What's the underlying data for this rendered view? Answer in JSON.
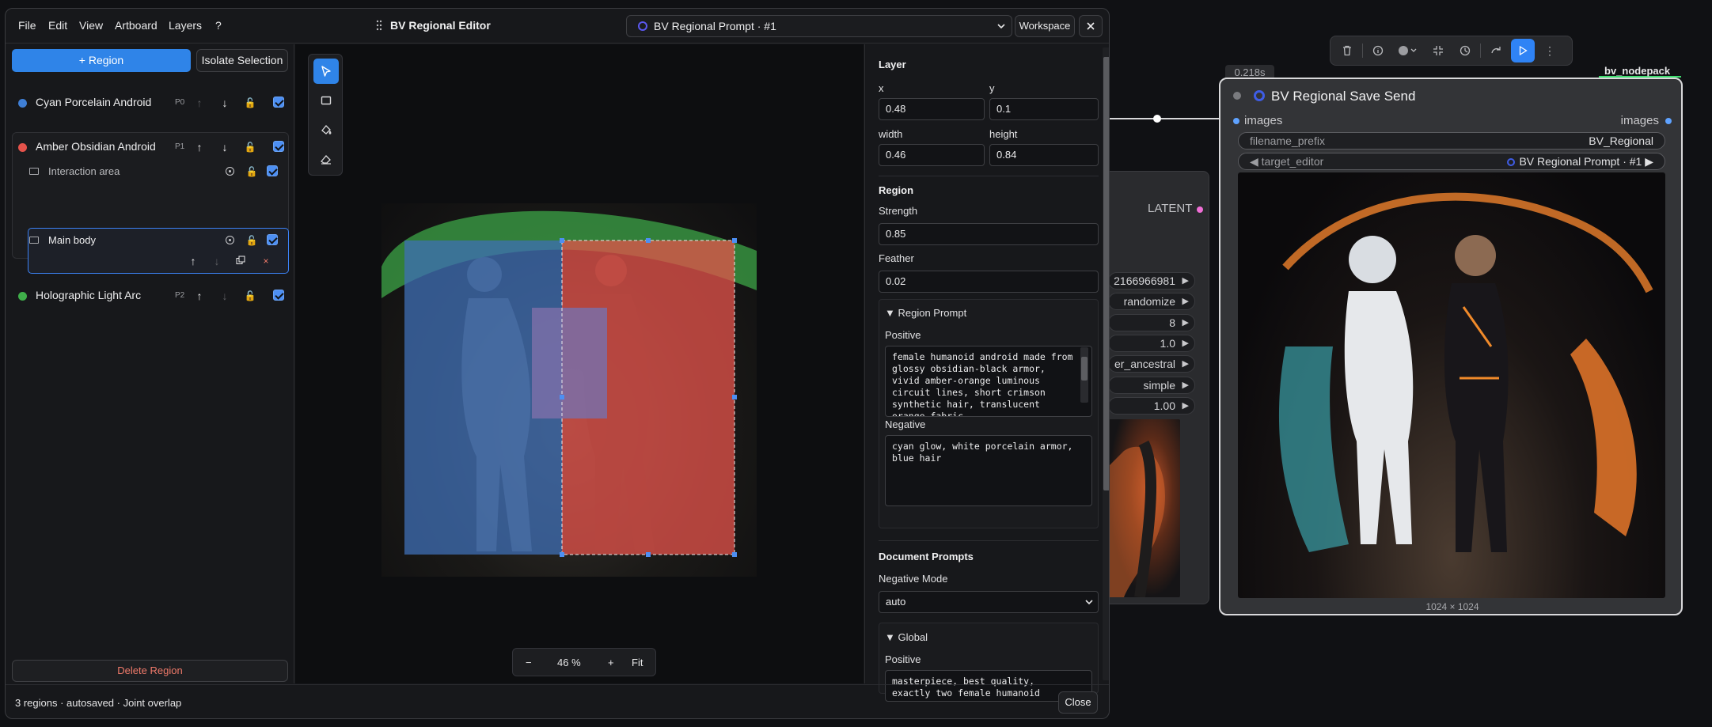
{
  "window": {
    "menu": [
      "File",
      "Edit",
      "View",
      "Artboard",
      "Layers",
      "?"
    ],
    "title": "BV Regional Editor",
    "prompt_select": "BV Regional Prompt · #1",
    "workspace_label": "Workspace",
    "close_icon": "close-icon"
  },
  "left_panel": {
    "add_region": "+ Region",
    "isolate": "Isolate Selection",
    "regions": [
      {
        "name": "Cyan Porcelain Android",
        "tag": "P0",
        "color": "#3f7fd6"
      },
      {
        "name": "Amber Obsidian Android",
        "tag": "P1",
        "color": "#e5534b"
      },
      {
        "name": "Holographic Light Arc",
        "tag": "P2",
        "color": "#3fae4a"
      }
    ],
    "sublayers": [
      "Interaction area",
      "Main body"
    ],
    "delete_region": "Delete Region"
  },
  "canvas": {
    "zoom_minus": "−",
    "zoom_level": "46 %",
    "zoom_plus": "+",
    "fit": "Fit"
  },
  "inspector": {
    "layer_heading": "Layer",
    "x_label": "x",
    "x_value": "0.48",
    "y_label": "y",
    "y_value": "0.1",
    "width_label": "width",
    "width_value": "0.46",
    "height_label": "height",
    "height_value": "0.84",
    "region_heading": "Region",
    "strength_label": "Strength",
    "strength_value": "0.85",
    "feather_label": "Feather",
    "feather_value": "0.02",
    "region_prompt_label": "▼ Region Prompt",
    "positive_label": "Positive",
    "positive_text": "female humanoid android made from glossy obsidian-black armor, vivid amber-orange luminous circuit lines, short crimson synthetic hair, translucent orange fabric",
    "negative_label": "Negative",
    "negative_text": "cyan glow, white porcelain armor, blue hair",
    "doc_prompts_heading": "Document Prompts",
    "negative_mode_label": "Negative Mode",
    "negative_mode_value": "auto",
    "global_label": "▼ Global",
    "global_positive_label": "Positive",
    "global_positive_text": "masterpiece, best quality, exactly two female humanoid"
  },
  "status": {
    "text": "3 regions · autosaved · Joint overlap",
    "close": "Close"
  },
  "graph": {
    "latent_label": "LATENT",
    "widgets": [
      "2166966981",
      "randomize",
      "8",
      "1.0",
      "er_ancestral",
      "simple",
      "1.00"
    ],
    "time_badge": "0.218s",
    "pack_badge": "bv_nodepack",
    "save_node": {
      "title": "BV Regional Save Send",
      "input_slot": "images",
      "output_slot": "images",
      "filename_label": "filename_prefix",
      "filename_value": "BV_Regional",
      "target_label": "◀ target_editor",
      "target_value": "BV Regional Prompt · #1",
      "dims": "1024 × 1024"
    }
  }
}
